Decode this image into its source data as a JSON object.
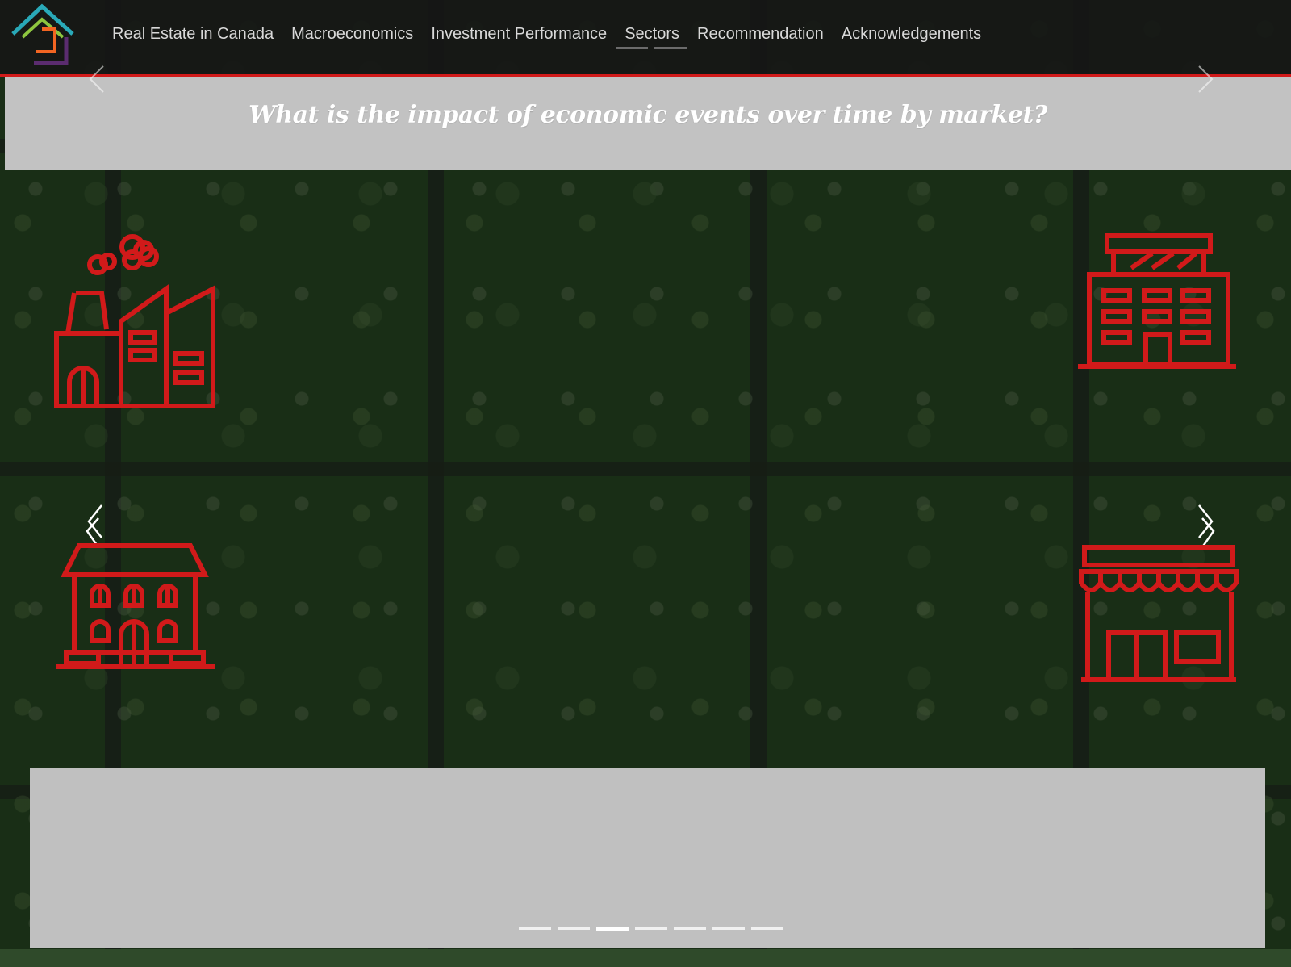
{
  "nav": {
    "items": [
      {
        "label": "Real Estate in Canada"
      },
      {
        "label": "Macroeconomics"
      },
      {
        "label": "Investment Performance"
      },
      {
        "label": "Sectors"
      },
      {
        "label": "Recommendation"
      },
      {
        "label": "Acknowledgements"
      }
    ]
  },
  "banner": {
    "question": "What is the impact of economic events over time by market?"
  },
  "icons": {
    "top_left": "industrial-factory-icon",
    "top_right": "office-building-icon",
    "bottom_left": "residential-house-icon",
    "bottom_right": "retail-store-icon",
    "accent_color": "#d11a1a"
  },
  "carousel": {
    "total_slides": 7,
    "active_slide": 3
  },
  "colors": {
    "nav_bg": "#161616",
    "accent_red": "#d11a1a",
    "banner_gray": "#c2c2c2"
  }
}
